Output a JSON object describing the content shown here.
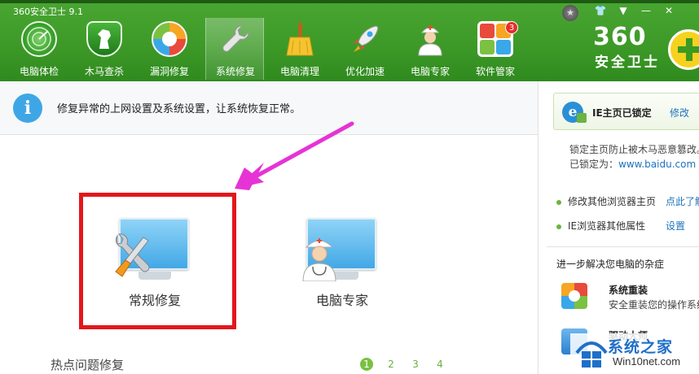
{
  "window": {
    "title": "360安全卫士 9.1",
    "controls": [
      "☆",
      "👕",
      "▼",
      "—",
      "✕"
    ]
  },
  "tabs": [
    {
      "label": "电脑体检",
      "icon": "radar-icon",
      "color": "#3fae3a"
    },
    {
      "label": "木马查杀",
      "icon": "horse-shield-icon",
      "color": "#2e8b2a"
    },
    {
      "label": "漏洞修复",
      "icon": "patch-icon",
      "color": "#f29c1f"
    },
    {
      "label": "系统修复",
      "icon": "wrench-icon",
      "color": "#d0d0d0",
      "active": true
    },
    {
      "label": "电脑清理",
      "icon": "broom-icon",
      "color": "#f2c12e"
    },
    {
      "label": "优化加速",
      "icon": "rocket-icon",
      "color": "#e8e8e8"
    },
    {
      "label": "电脑专家",
      "icon": "doctor-icon",
      "color": "#ffffff"
    },
    {
      "label": "软件管家",
      "icon": "apps-icon",
      "color": "#e84d3c",
      "badge": "3"
    }
  ],
  "brand": {
    "number": "360",
    "name": "安全卫士"
  },
  "info": {
    "icon": "i",
    "text": "修复异常的上网设置及系统设置，让系统恢复正常。"
  },
  "tools": [
    {
      "label": "常规修复",
      "icon": "tools-monitor-icon"
    },
    {
      "label": "电脑专家",
      "icon": "doctor-monitor-icon"
    }
  ],
  "hot": {
    "title": "热点问题修复",
    "pages": [
      "1",
      "2",
      "3",
      "4"
    ],
    "current_page": 1
  },
  "sidebar": {
    "lock_title": "IE主页已锁定",
    "modify": "修改",
    "lock_desc": "锁定主页防止被木马恶意篡改。",
    "locked_label": "已锁定为：",
    "locked_url": "www.baidu.com",
    "options": [
      {
        "text": "修改其他浏览器主页",
        "link": "点此了解"
      },
      {
        "text": "IE浏览器其他属性",
        "link": "设置"
      }
    ],
    "more_title": "进一步解决您电脑的杂症",
    "more_items": [
      {
        "title": "系统重装",
        "desc": "安全重装您的操作系统"
      },
      {
        "title": "驱动大师",
        "desc": ""
      }
    ]
  },
  "watermark": {
    "name": "系统之家",
    "url": "Win10net.com"
  },
  "colors": {
    "header": "#3e9a28",
    "highlight": "#e3171b",
    "arrow": "#e633d6",
    "link": "#1e73be"
  }
}
